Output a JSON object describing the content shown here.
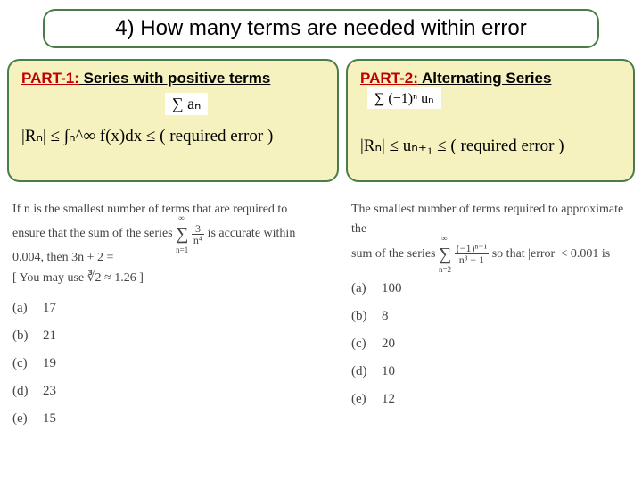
{
  "title": "4) How many terms are needed within error",
  "part1": {
    "label_prefix": "PART-1:",
    "label_rest": "  Series with positive terms",
    "sigma": "∑ aₙ",
    "formula": "|Rₙ| ≤ ∫ₙ^∞ f(x)dx ≤ ( required error )"
  },
  "part2": {
    "label_prefix": "PART-2:",
    "label_rest": "  Alternating Series",
    "sigma": "∑ (−1)ⁿ uₙ",
    "formula": "|Rₙ| ≤ uₙ₊₁ ≤ ( required error )"
  },
  "q1": {
    "text_a": "If n is the smallest number of terms that are required to",
    "text_b": "ensure that the sum of the series",
    "series_num": "3",
    "series_den": "n⁴",
    "text_c": "is accurate within",
    "text_d": "0.004, then 3n + 2 =",
    "hint": "[ You may use ∛2 ≈ 1.26 ]",
    "opts": [
      {
        "l": "(a)",
        "v": "17"
      },
      {
        "l": "(b)",
        "v": "21"
      },
      {
        "l": "(c)",
        "v": "19"
      },
      {
        "l": "(d)",
        "v": "23"
      },
      {
        "l": "(e)",
        "v": "15"
      }
    ]
  },
  "q2": {
    "text_a": "The smallest number of terms required to approximate the",
    "text_b": "sum of the series",
    "series_num": "(−1)ⁿ⁺¹",
    "series_den": "n³ − 1",
    "text_c": "so that |error| < 0.001 is",
    "opts": [
      {
        "l": "(a)",
        "v": "100"
      },
      {
        "l": "(b)",
        "v": "8"
      },
      {
        "l": "(c)",
        "v": "20"
      },
      {
        "l": "(d)",
        "v": "10"
      },
      {
        "l": "(e)",
        "v": "12"
      }
    ]
  }
}
